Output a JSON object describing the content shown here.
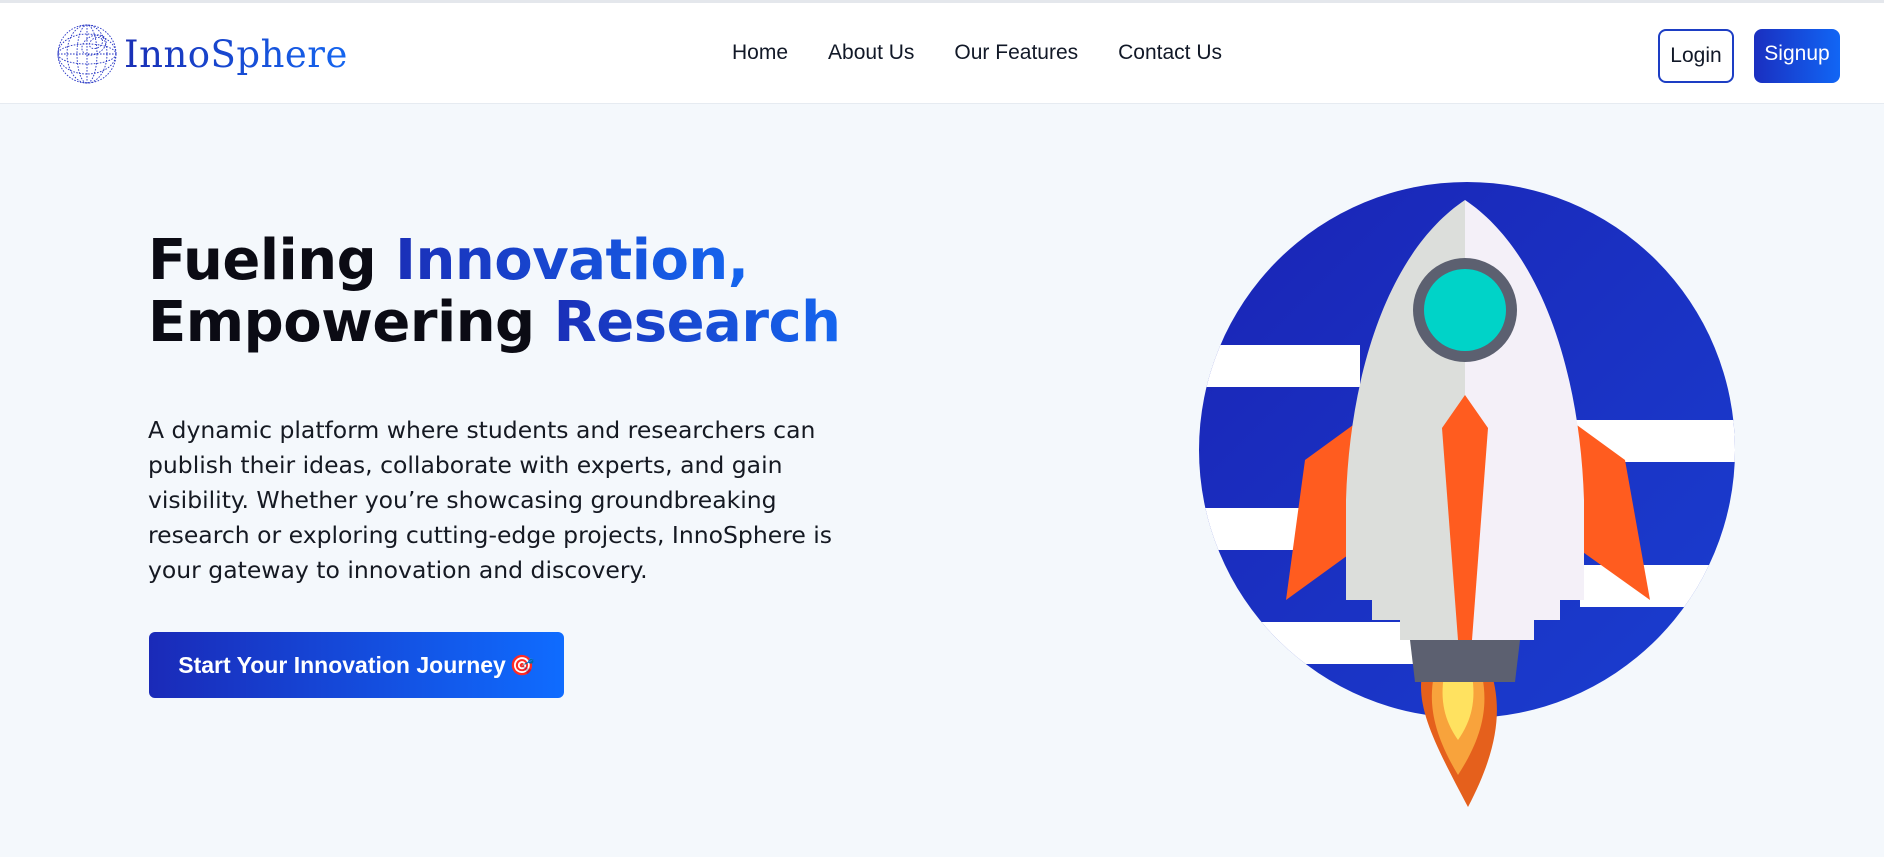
{
  "header": {
    "brand": "InnoSphere",
    "nav": [
      "Home",
      "About Us",
      "Our Features",
      "Contact Us"
    ],
    "login_label": "Login",
    "signup_label": "Signup"
  },
  "hero": {
    "title_line1_plain": "Fueling ",
    "title_line1_accent": "Innovation,",
    "title_line2_plain": "Empowering ",
    "title_line2_accent": "Research",
    "description": "A dynamic platform where students and researchers can publish their ideas, collaborate with experts, and gain visibility. Whether you’re showcasing groundbreaking research or exploring cutting-edge projects, InnoSphere is your gateway to innovation and discovery.",
    "cta_label": "Start Your Innovation Journey",
    "cta_emoji": "🎯"
  },
  "colors": {
    "brand_blue": "#1a2fb8",
    "accent_blue": "#1566ef",
    "rocket_orange": "#ff5c1f",
    "window_teal": "#00d3c8"
  },
  "icons": {
    "logo": "globe-icon",
    "hero_art": "rocket-illustration"
  }
}
